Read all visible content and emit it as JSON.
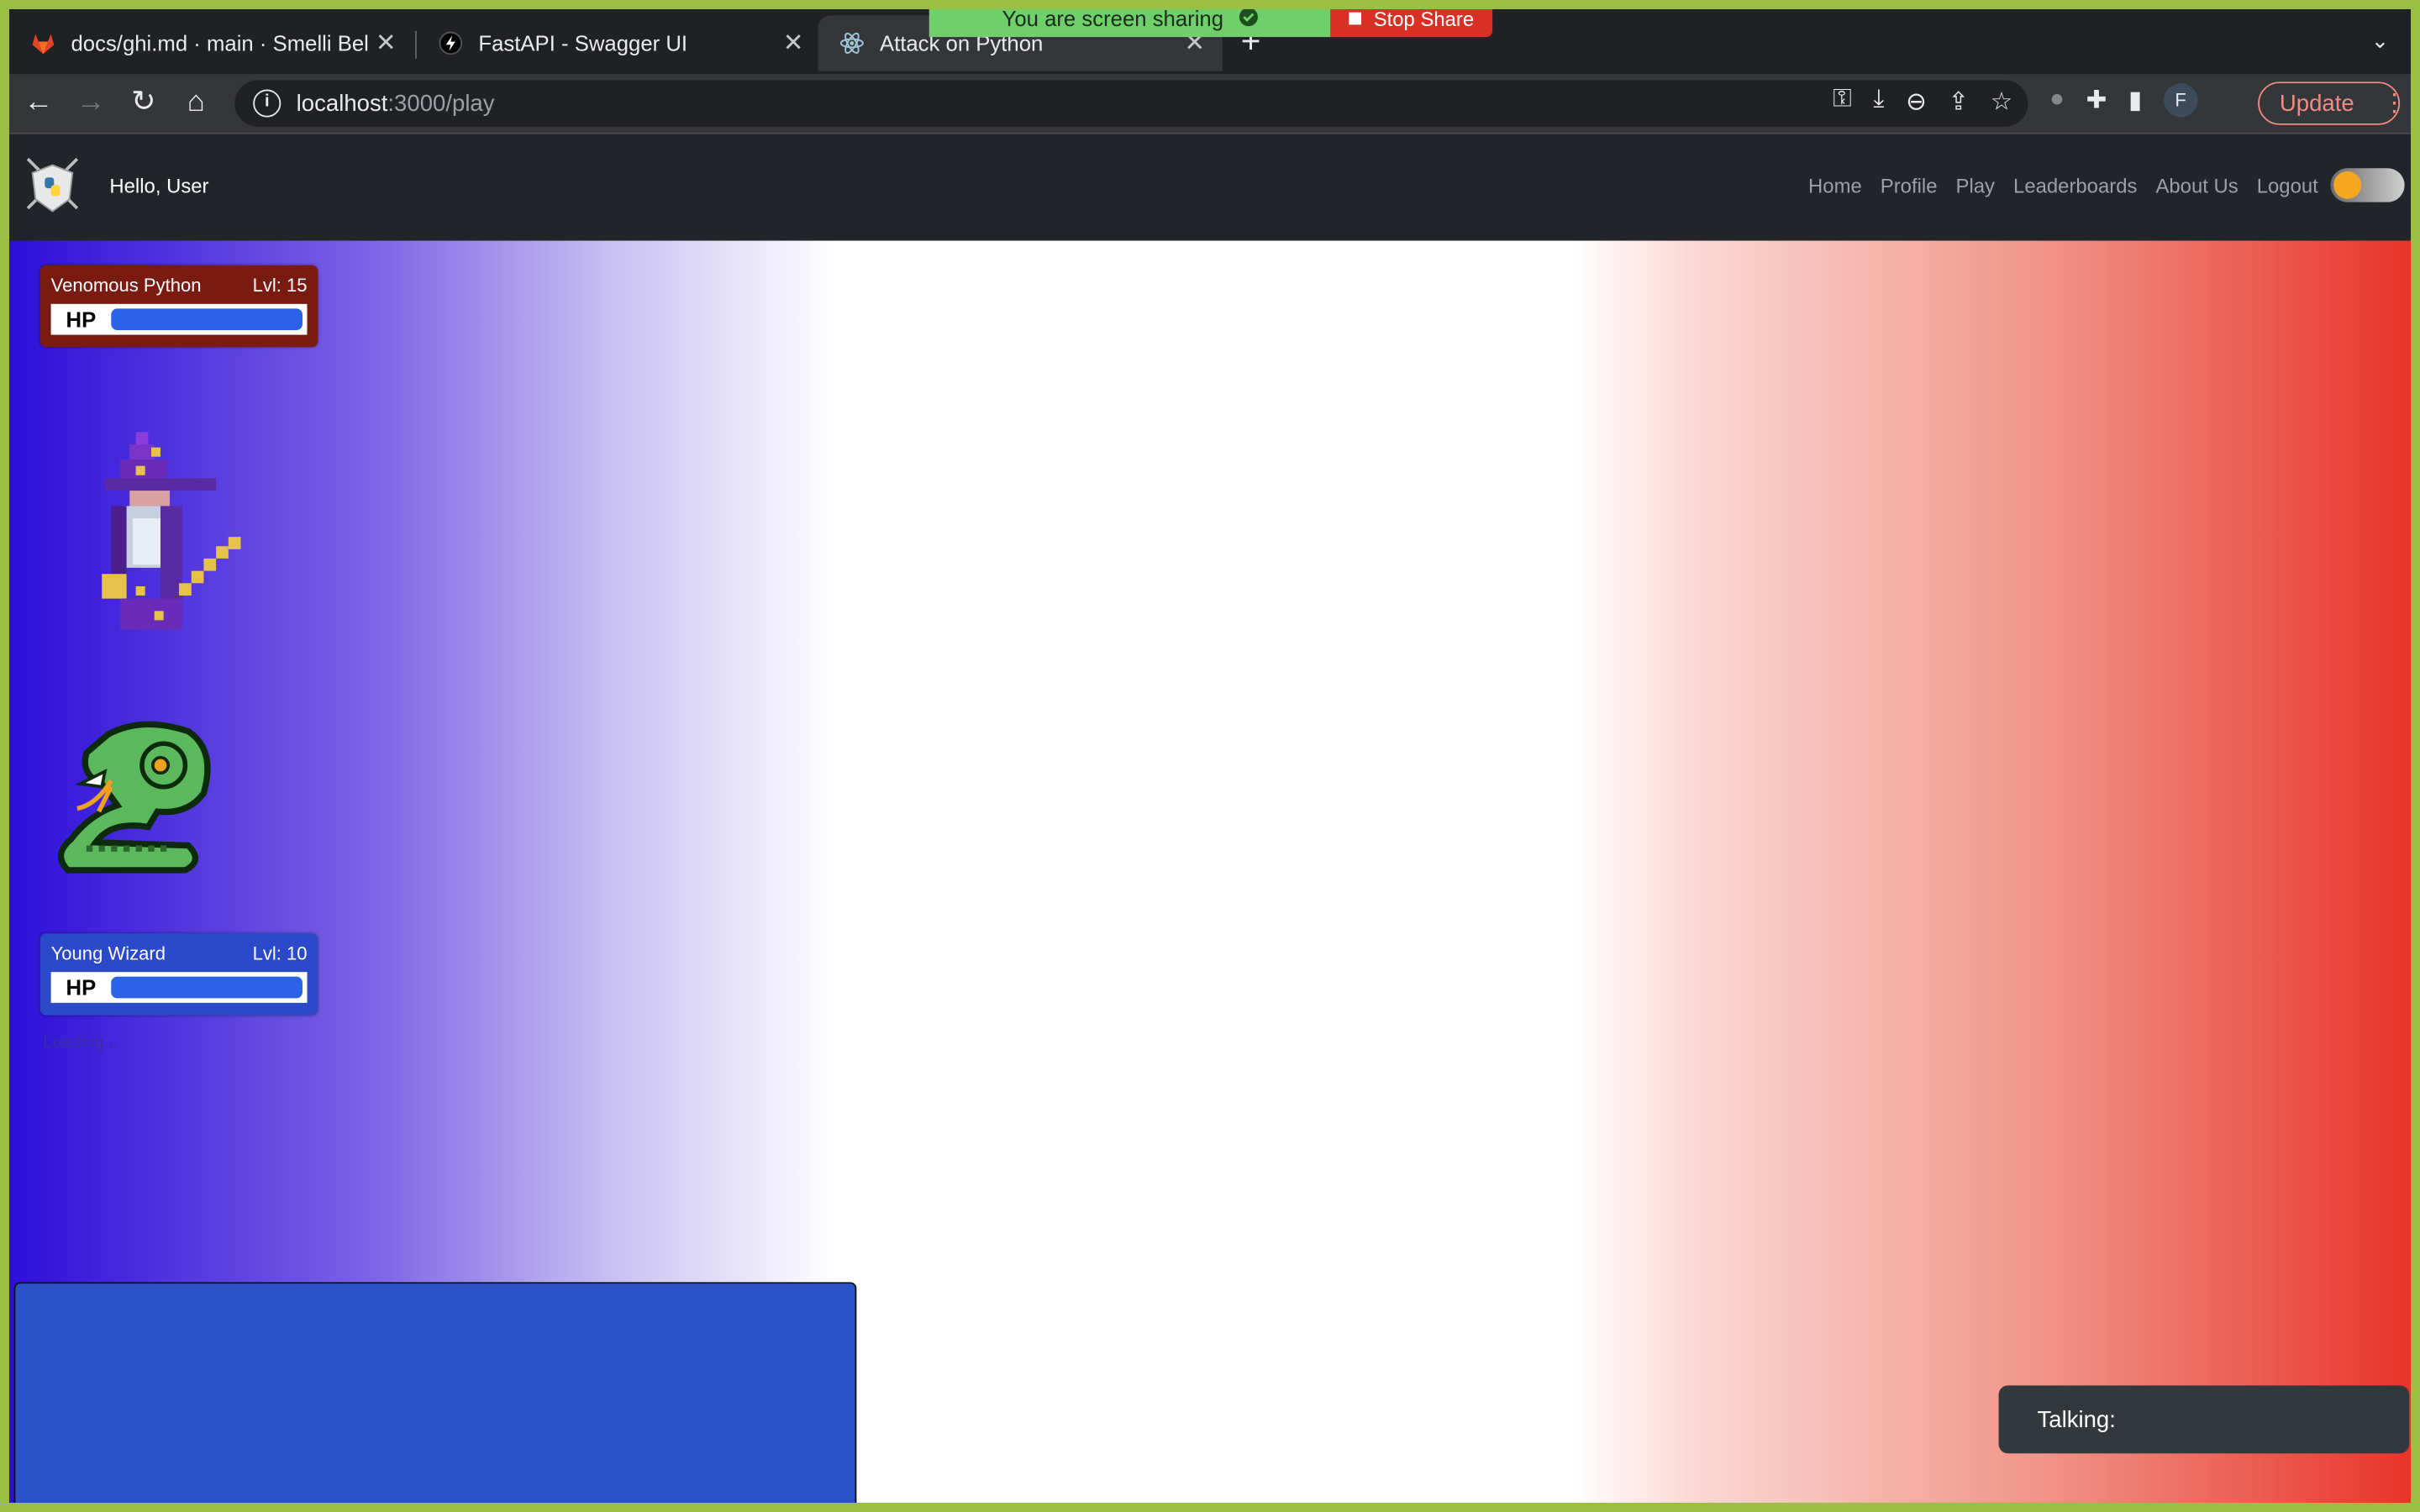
{
  "browser": {
    "tabs": [
      {
        "title": "docs/ghi.md · main · Smelli Bel",
        "icon": "gitlab-icon",
        "active": false
      },
      {
        "title": "FastAPI - Swagger UI",
        "icon": "fastapi-icon",
        "active": false
      },
      {
        "title": "Attack on Python",
        "icon": "react-icon",
        "active": true
      }
    ],
    "new_tab": "+",
    "share_banner": {
      "message": "You are screen sharing",
      "stop_label": "Stop Share"
    },
    "url": {
      "host": "localhost",
      "path": ":3000/play"
    },
    "update_label": "Update",
    "profile_initial": "F"
  },
  "app": {
    "greeting": "Hello, User",
    "nav": [
      "Home",
      "Profile",
      "Play",
      "Leaderboards",
      "About Us",
      "Logout"
    ]
  },
  "battle": {
    "enemy": {
      "name": "Venomous Python",
      "level": "Lvl: 15",
      "hp_label": "HP",
      "hp_fraction": 1.0
    },
    "player": {
      "name": "Young Wizard",
      "level": "Lvl: 10",
      "hp_label": "HP",
      "hp_fraction": 1.0
    },
    "status": "Loading...",
    "talking_label": "Talking:"
  },
  "colors": {
    "gradient_left": "#2d0ed8",
    "gradient_right": "#e8342a",
    "hp_fill": "#2c62e8",
    "enemy_card": "#7a1b12",
    "player_card": "#2b49c9",
    "share_green": "#6fcf6a",
    "stop_red": "#d93025"
  }
}
